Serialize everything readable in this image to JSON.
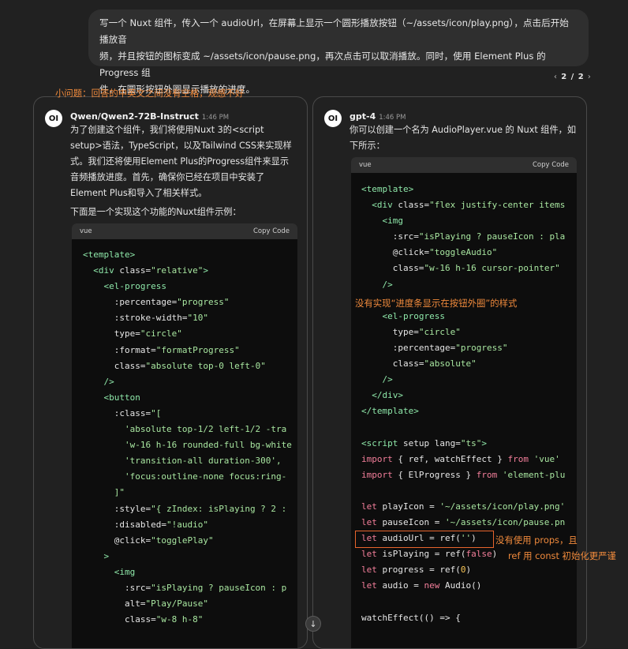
{
  "user_prompt": {
    "line1": "写一个 Nuxt 组件，传入一个 audioUrl，在屏幕上显示一个圆形播放按钮（~/assets/icon/play.png），点击后开始播放音",
    "line2": "频，并且按钮的图标变成 ~/assets/icon/pause.png，再次点击可以取消播放。同时，使用 Element Plus 的 Progress 组",
    "line3": "件，在圆形按钮外圈显示播放的进度。"
  },
  "pager": {
    "prev": "‹",
    "current": "2 / 2",
    "next": "›"
  },
  "annotations": {
    "left_top": "小问题：回答的中英文之间没有空格，观感不好",
    "right_progress": "没有实现“进度条显示在按钮外圈”的样式",
    "right_props_1": "没有使用 props，且",
    "right_props_2": "ref 用 const 初始化更严谨"
  },
  "left": {
    "avatar": "OI",
    "model": "Qwen/Qwen2-72B-Instruct",
    "time": "1:46 PM",
    "para1": [
      "为了创建这个组件，我们将使用Nuxt 3的<script",
      "setup>语法，TypeScript，以及Tailwind CSS来实现样",
      "式。我们还将使用Element Plus的Progress组件来显示",
      "音频播放进度。首先，确保你已经在项目中安装了",
      "Element Plus和导入了相关样式。"
    ],
    "para2": "下面是一个实现这个功能的Nuxt组件示例：",
    "code_lang": "vue",
    "copy": "Copy Code"
  },
  "right": {
    "avatar": "OI",
    "model": "gpt-4",
    "time": "1:46 PM",
    "para1": [
      "你可以创建一个名为 AudioPlayer.vue 的 Nuxt 组件，如",
      "下所示："
    ],
    "code_lang": "vue",
    "copy": "Copy Code"
  },
  "scroll_icon": "↓"
}
